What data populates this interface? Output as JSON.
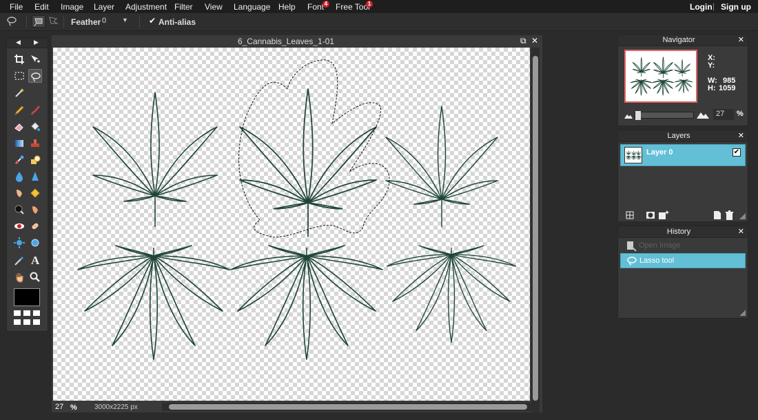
{
  "menubar": {
    "items": [
      {
        "label": "File",
        "badge": ""
      },
      {
        "label": "Edit",
        "badge": ""
      },
      {
        "label": "Image",
        "badge": ""
      },
      {
        "label": "Layer",
        "badge": ""
      },
      {
        "label": "Adjustment",
        "badge": ""
      },
      {
        "label": "Filter",
        "badge": ""
      },
      {
        "label": "View",
        "badge": ""
      },
      {
        "label": "Language",
        "badge": ""
      },
      {
        "label": "Help",
        "badge": ""
      },
      {
        "label": "Font",
        "badge": "4"
      },
      {
        "label": "Free Tool",
        "badge": "1"
      }
    ],
    "login": "Login",
    "separator": "|",
    "signup": "Sign up"
  },
  "options": {
    "feather_label": "Feather:",
    "feather_value": "0",
    "antialias_label": "Anti-alias",
    "antialias_checked": true
  },
  "tools": {
    "icons": [
      "crop-icon",
      "move-icon",
      "marquee-icon",
      "lasso-icon",
      "magic-wand-icon",
      "pencil-icon",
      "brush-icon",
      "eraser-icon",
      "paint-bucket-icon",
      "gradient-icon",
      "clone-stamp-icon",
      "color-replace-icon",
      "drawing-icon",
      "blur-icon",
      "sharpen-icon",
      "smudge-icon",
      "sponge-icon",
      "dodge-icon",
      "burn-icon",
      "red-eye-icon",
      "spot-heal-icon",
      "bloat-icon",
      "pinch-icon",
      "color-picker-icon",
      "type-icon",
      "hand-icon",
      "zoom-icon"
    ],
    "active": "lasso-icon",
    "foreground_color": "#000000",
    "background_color": "#ffffff"
  },
  "document": {
    "title": "6_Cannabis_Leaves_1-01",
    "zoom": "27",
    "zoom_unit": "%",
    "dimensions": "3000x2225 px",
    "leaf_color": "#1f4638",
    "selection_active": true
  },
  "navigator": {
    "title": "Navigator",
    "x_label": "X:",
    "y_label": "Y:",
    "w_label": "W:",
    "w_value": "985",
    "h_label": "H:",
    "h_value": "1059",
    "zoom_value": "27",
    "zoom_unit": "%",
    "viewport_color": "#e06363"
  },
  "layers": {
    "title": "Layers",
    "items": [
      {
        "name": "Layer 0",
        "visible": true,
        "selected": true
      }
    ],
    "accent": "#63bfd6"
  },
  "history": {
    "title": "History",
    "items": [
      {
        "label": "Open Image",
        "icon": "open-image-icon",
        "active": false
      },
      {
        "label": "Lasso tool",
        "icon": "lasso-icon",
        "active": true
      }
    ]
  }
}
